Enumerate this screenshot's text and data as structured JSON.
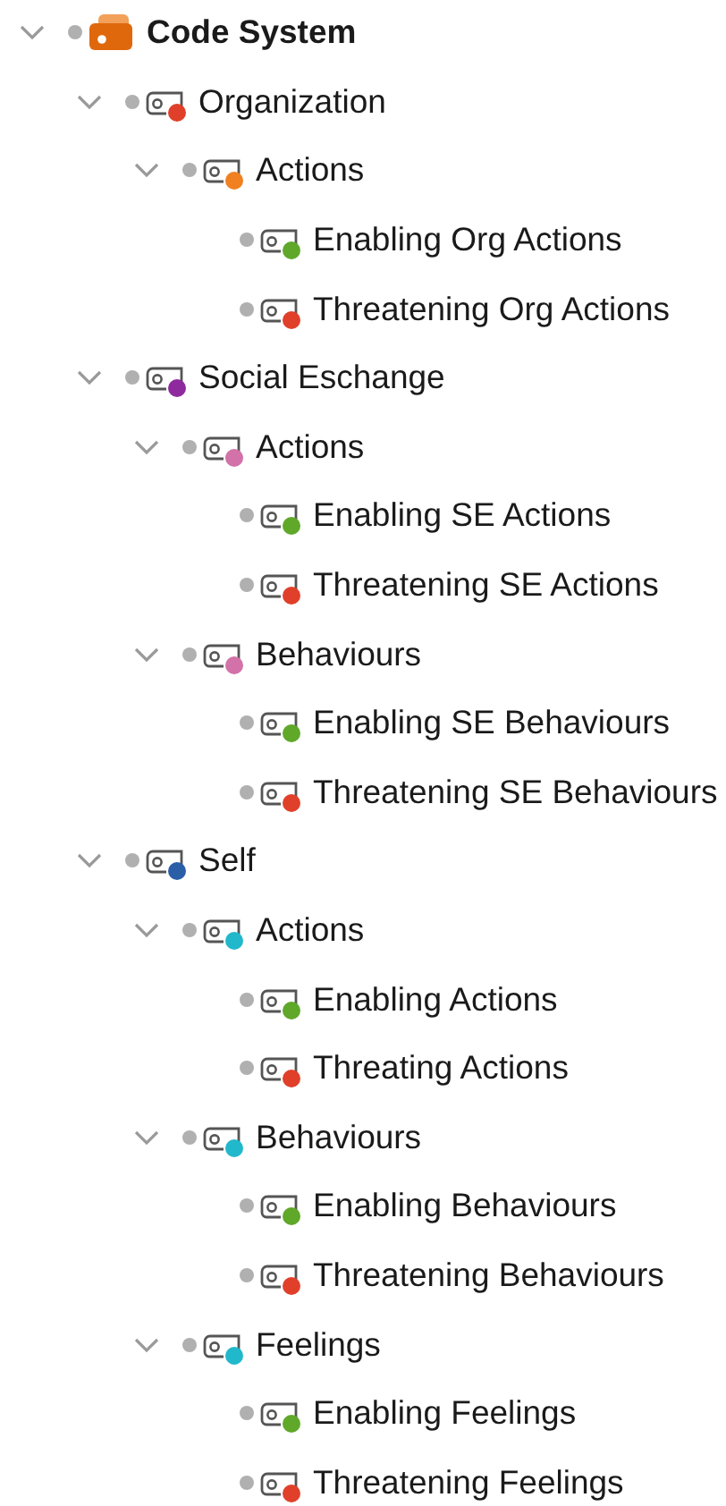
{
  "code_system": {
    "label": "Code System",
    "kind": "root",
    "expanded": true,
    "children": [
      {
        "label": "Organization",
        "kind": "code",
        "color": "#e0402a",
        "expanded": true,
        "children": [
          {
            "label": "Actions",
            "kind": "code",
            "color": "#f08020",
            "expanded": true,
            "children": [
              {
                "label": "Enabling Org Actions",
                "kind": "code",
                "color": "#5fa82a"
              },
              {
                "label": "Threatening Org Actions",
                "kind": "code",
                "color": "#e0402a"
              }
            ]
          }
        ]
      },
      {
        "label": "Social Eschange",
        "kind": "code",
        "color": "#8e2a9e",
        "expanded": true,
        "children": [
          {
            "label": "Actions",
            "kind": "code",
            "color": "#d272a8",
            "expanded": true,
            "children": [
              {
                "label": "Enabling SE Actions",
                "kind": "code",
                "color": "#5fa82a"
              },
              {
                "label": "Threatening SE Actions",
                "kind": "code",
                "color": "#e0402a"
              }
            ]
          },
          {
            "label": "Behaviours",
            "kind": "code",
            "color": "#d272a8",
            "expanded": true,
            "children": [
              {
                "label": "Enabling SE Behaviours",
                "kind": "code",
                "color": "#5fa82a"
              },
              {
                "label": "Threatening SE Behaviours",
                "kind": "code",
                "color": "#e0402a"
              }
            ]
          }
        ]
      },
      {
        "label": "Self",
        "kind": "code",
        "color": "#2a5fa8",
        "expanded": true,
        "children": [
          {
            "label": "Actions",
            "kind": "code",
            "color": "#22b8cc",
            "expanded": true,
            "children": [
              {
                "label": "Enabling Actions",
                "kind": "code",
                "color": "#5fa82a"
              },
              {
                "label": "Threating Actions",
                "kind": "code",
                "color": "#e0402a"
              }
            ]
          },
          {
            "label": "Behaviours",
            "kind": "code",
            "color": "#22b8cc",
            "expanded": true,
            "children": [
              {
                "label": "Enabling Behaviours",
                "kind": "code",
                "color": "#5fa82a"
              },
              {
                "label": "Threatening Behaviours",
                "kind": "code",
                "color": "#e0402a"
              }
            ]
          },
          {
            "label": "Feelings",
            "kind": "code",
            "color": "#22b8cc",
            "expanded": true,
            "children": [
              {
                "label": "Enabling Feelings",
                "kind": "code",
                "color": "#5fa82a"
              },
              {
                "label": "Threatening Feelings",
                "kind": "code",
                "color": "#e0402a"
              }
            ]
          }
        ]
      }
    ]
  }
}
